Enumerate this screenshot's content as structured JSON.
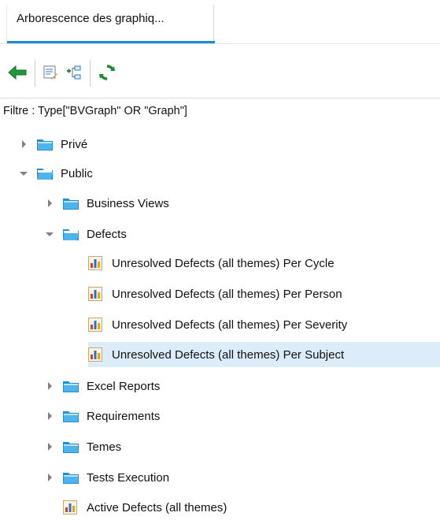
{
  "tab": {
    "label": "Arborescence des graphiq..."
  },
  "toolbar": {
    "buttons": [
      {
        "icon": "back-arrow-icon"
      },
      {
        "icon": "properties-icon"
      },
      {
        "icon": "hierarchy-icon"
      },
      {
        "icon": "refresh-icon"
      }
    ]
  },
  "filter": {
    "text": "Filtre : Type[\"BVGraph\" OR \"Graph\"]"
  },
  "tree": {
    "prive": "Privé",
    "public": "Public",
    "business_views": "Business Views",
    "defects": "Defects",
    "graph_cycle": "Unresolved Defects (all themes) Per Cycle",
    "graph_person": "Unresolved Defects (all themes) Per Person",
    "graph_severity": "Unresolved Defects (all themes) Per Severity",
    "graph_subject": "Unresolved Defects (all themes) Per Subject",
    "excel_reports": "Excel Reports",
    "requirements": "Requirements",
    "temes": "Temes",
    "tests_execution": "Tests Execution",
    "active_defects": "Active Defects (all themes)"
  },
  "colors": {
    "accent": "#1b8ad0",
    "selection": "#dcecf9",
    "folder": "#1c8fd6"
  }
}
